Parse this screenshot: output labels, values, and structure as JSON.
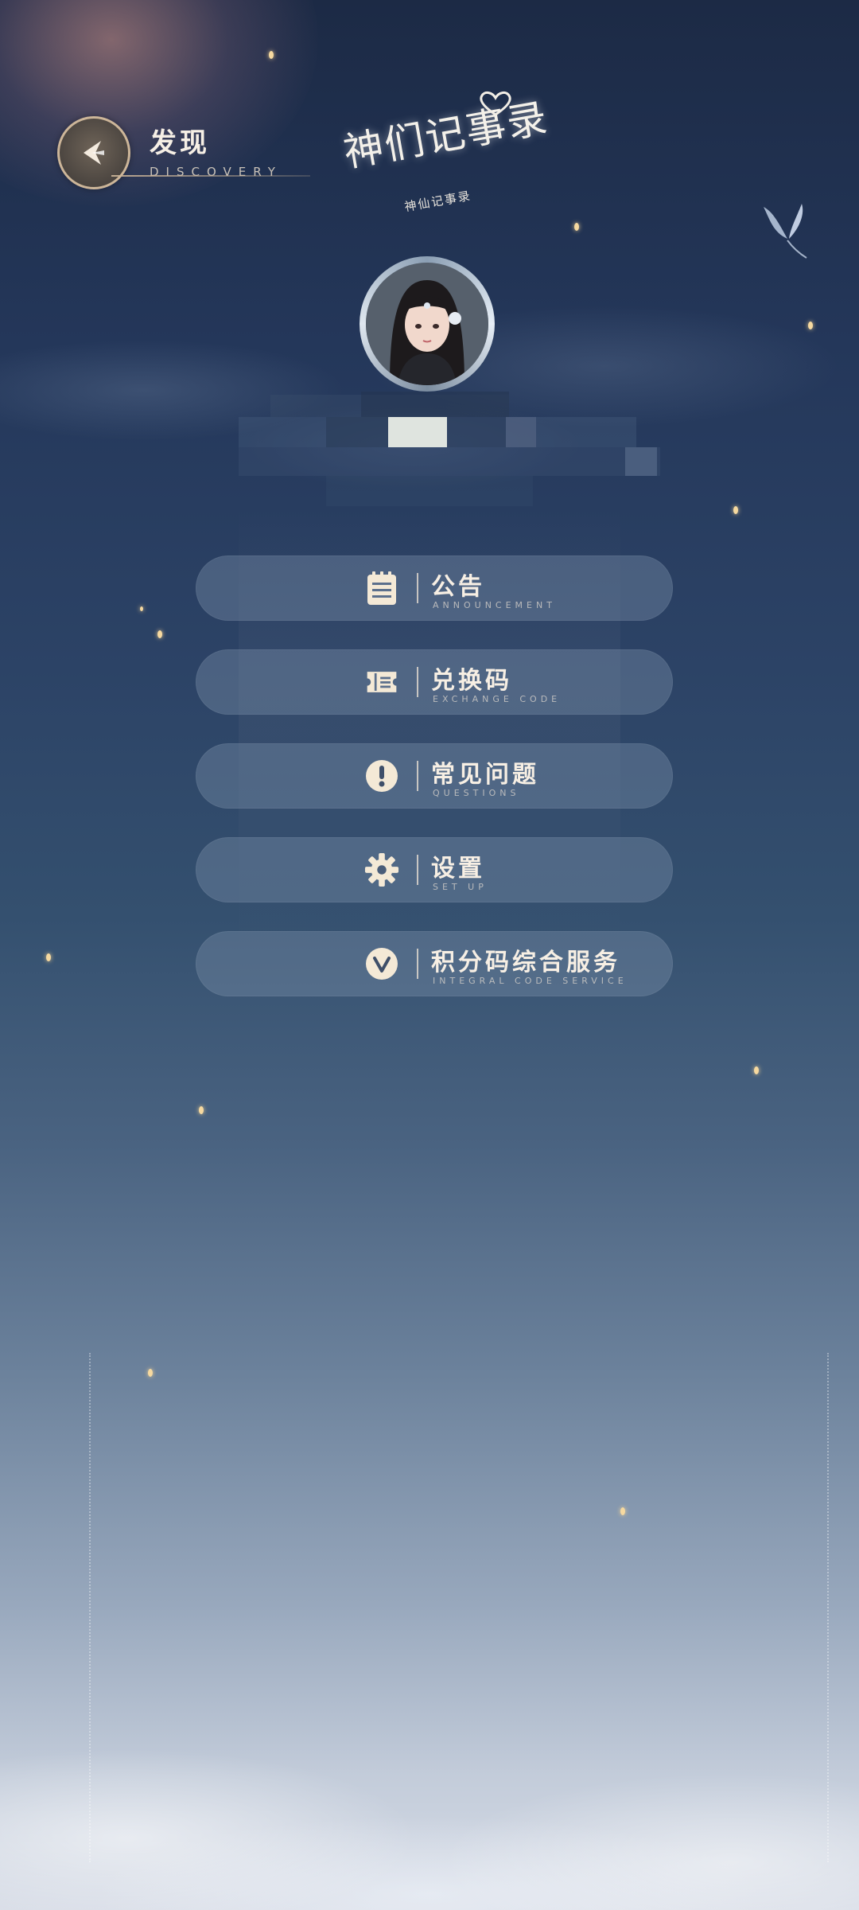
{
  "header": {
    "title": "发现",
    "subtitle": "DISCOVERY",
    "back_icon": "back-arrow-icon"
  },
  "logo": {
    "title": "神们记事录",
    "subtitle": "神仙记事录"
  },
  "profile": {
    "avatar_icon": "character-portrait"
  },
  "menu": {
    "items": [
      {
        "label": "公告",
        "sub": "ANNOUNCEMENT",
        "icon": "notice-icon"
      },
      {
        "label": "兑换码",
        "sub": "EXCHANGE CODE",
        "icon": "ticket-icon"
      },
      {
        "label": "常见问题",
        "sub": "QUESTIONS",
        "icon": "exclamation-icon"
      },
      {
        "label": "设置",
        "sub": "SET UP",
        "icon": "gear-icon"
      },
      {
        "label": "积分码综合服务",
        "sub": "INTEGRAL CODE SERVICE",
        "icon": "v-badge-icon"
      }
    ]
  },
  "colors": {
    "accent_gold": "#cdb699",
    "text_cream": "#f7efe4",
    "icon_cream": "#f4e9d6"
  }
}
